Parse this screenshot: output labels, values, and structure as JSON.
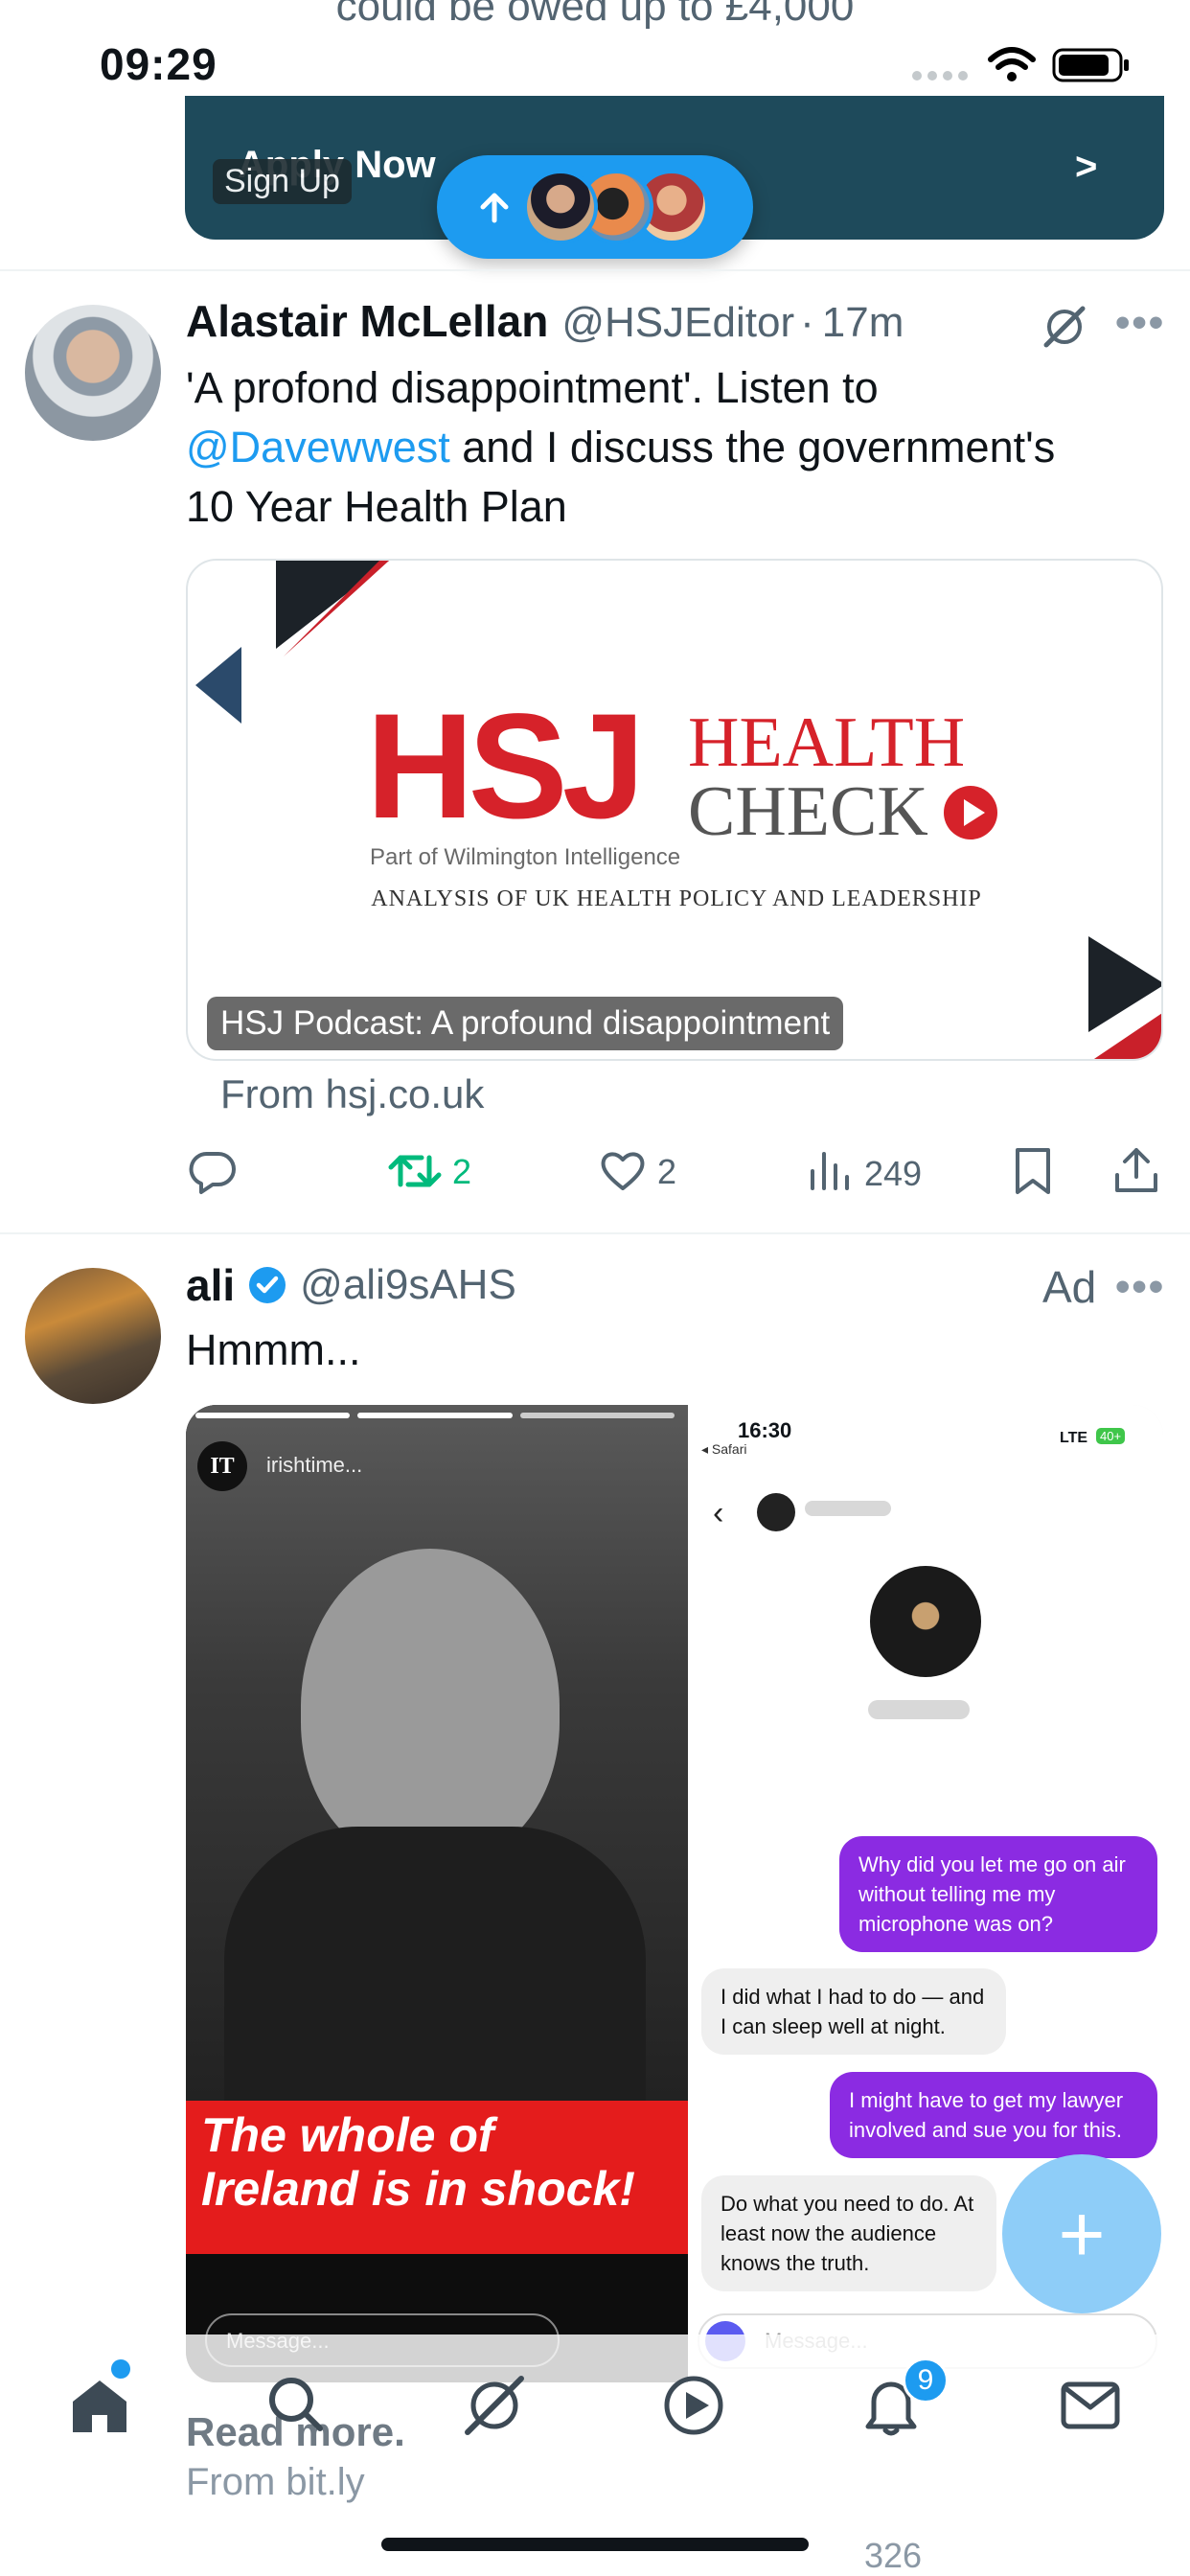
{
  "status_bar": {
    "time": "09:29"
  },
  "ad_peek": {
    "text": "could be owed up to £4,000"
  },
  "promo": {
    "apply_label": "Apply Now",
    "arrow_label": ">",
    "signup_label": "Sign Up"
  },
  "tweet1": {
    "name": "Alastair McLellan",
    "handle": "@HSJEditor",
    "separator": "·",
    "time": "17m",
    "text_before": "'A profond disappointment'. Listen to ",
    "mention": "@Davewwest",
    "text_after_line1": " and I discuss the government's",
    "text_line3": "10 Year Health Plan",
    "card": {
      "brand_hsj": "HSJ",
      "brand_health": "HEALTH",
      "brand_check": "CHECK",
      "part_of": "Part of Wilmington Intelligence",
      "subtitle": "ANALYSIS OF UK HEALTH POLICY AND LEADERSHIP",
      "caption": "HSJ Podcast: A profound disappointment"
    },
    "from": "From hsj.co.uk",
    "actions": {
      "reposts": "2",
      "likes": "2",
      "views": "249"
    }
  },
  "tweet2": {
    "name": "ali",
    "handle": "@ali9sAHS",
    "ad_label": "Ad",
    "text": "Hmmm...",
    "media": {
      "story_account": "irishtime...",
      "story_logo": "IT",
      "headline_line1": "The whole of",
      "headline_line2": "Ireland is in shock!",
      "story_message_placeholder": "Message...",
      "phone_time": "16:30",
      "phone_back_app": "◂ Safari",
      "phone_network": "LTE",
      "phone_battery": "40+",
      "chat": [
        {
          "from": "out",
          "text": "Why did you let me go on air without telling me my microphone was on?"
        },
        {
          "from": "in",
          "text": "I did what I had to do — and I can sleep well at night."
        },
        {
          "from": "out",
          "text": "I might have to get my lawyer involved and sue you for this."
        },
        {
          "from": "in",
          "text": "Do what you need to do. At least now the audience knows the truth."
        }
      ],
      "dm_placeholder": "Message..."
    },
    "read_more": "Read more.",
    "from": "From bit.ly",
    "actions": {
      "views": "326"
    }
  },
  "bottom_nav": {
    "notifications_badge": "9"
  },
  "colors": {
    "accent": "#1d9bf0",
    "repost_active": "#00ba7c",
    "promo_bg": "#1e4a5b",
    "hsj_red": "#d6222a"
  }
}
